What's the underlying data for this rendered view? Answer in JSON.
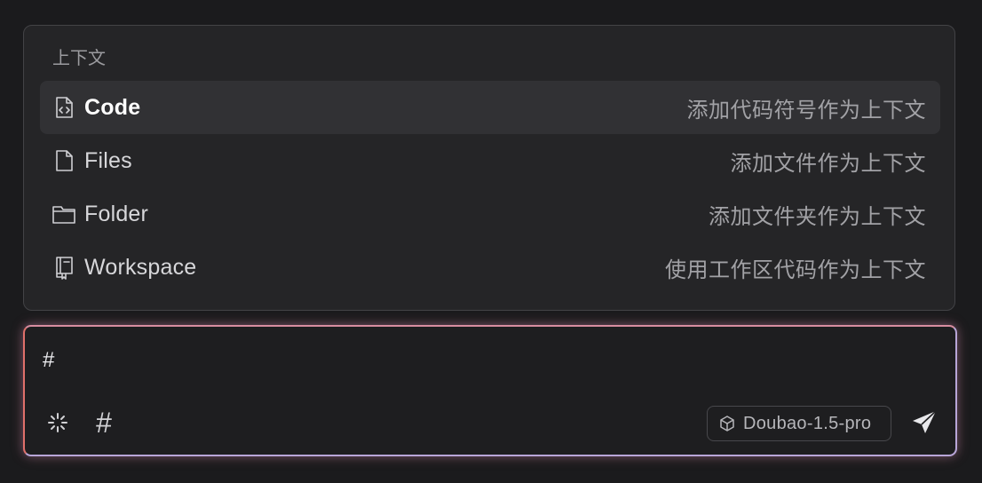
{
  "context_menu": {
    "header": "上下文",
    "items": [
      {
        "label": "Code",
        "desc": "添加代码符号作为上下文",
        "icon": "code-file-icon"
      },
      {
        "label": "Files",
        "desc": "添加文件作为上下文",
        "icon": "file-icon"
      },
      {
        "label": "Folder",
        "desc": "添加文件夹作为上下文",
        "icon": "folder-icon"
      },
      {
        "label": "Workspace",
        "desc": "使用工作区代码作为上下文",
        "icon": "workspace-book-icon"
      }
    ]
  },
  "input": {
    "value": "#"
  },
  "toolbar": {
    "sparkle_icon": "sparkle-icon",
    "hash_label": "#",
    "model_label": "Doubao-1.5-pro",
    "model_icon": "cube-icon",
    "send_icon": "send-icon"
  },
  "colors": {
    "background": "#1b1b1d",
    "panel": "#252527",
    "active_row": "#313134",
    "glow_left": "#e0706a",
    "glow_right": "#b8a6d8"
  }
}
